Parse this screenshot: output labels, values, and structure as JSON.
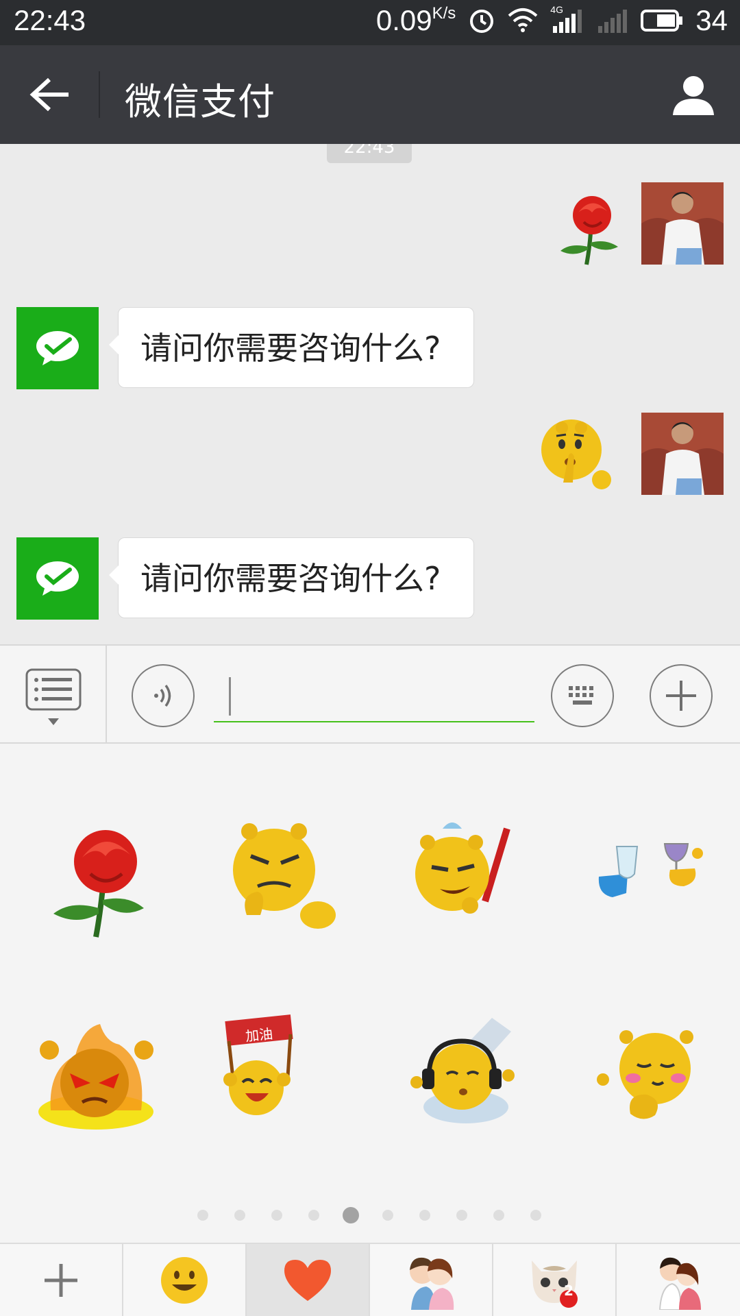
{
  "status_bar": {
    "time": "22:43",
    "net_speed": "0.09",
    "net_unit": "K/s",
    "network_type": "4G",
    "battery_level": "34"
  },
  "header": {
    "title": "微信支付"
  },
  "chat": {
    "time_divider": "22:43",
    "messages": [
      {
        "sender": "user",
        "type": "sticker",
        "sticker_icon": "rose-sticker"
      },
      {
        "sender": "wechat-pay",
        "type": "text",
        "text": "请问你需要咨询什么?"
      },
      {
        "sender": "user",
        "type": "sticker",
        "sticker_icon": "shush-emoji-sticker"
      },
      {
        "sender": "wechat-pay",
        "type": "text",
        "text": "请问你需要咨询什么?"
      }
    ]
  },
  "input_bar": {
    "text_value": ""
  },
  "sticker_panel": {
    "stickers": [
      "rose-sticker",
      "thinking-smirk-sticker",
      "sly-flag-sticker",
      "cheers-drinks-sticker",
      "angry-fire-sticker",
      "jiayou-cheer-sticker",
      "headphones-music-sticker",
      "shy-blush-sticker"
    ],
    "jiayou_text": "加油",
    "page_count": 10,
    "active_page": 5
  },
  "tab_bar": {
    "tabs": [
      "add-icon",
      "smiley-icon",
      "heart-icon",
      "couple-sticker-icon",
      "cat-sticker-icon",
      "lovers-sticker-icon"
    ],
    "selected_tab": 2,
    "cat_badge": "2"
  },
  "colors": {
    "header_bg": "#393a3f",
    "status_bg": "#2b2d30",
    "wechat_green": "#1aad19",
    "input_underline": "#45c01a",
    "chat_bg": "#ebebeb"
  }
}
